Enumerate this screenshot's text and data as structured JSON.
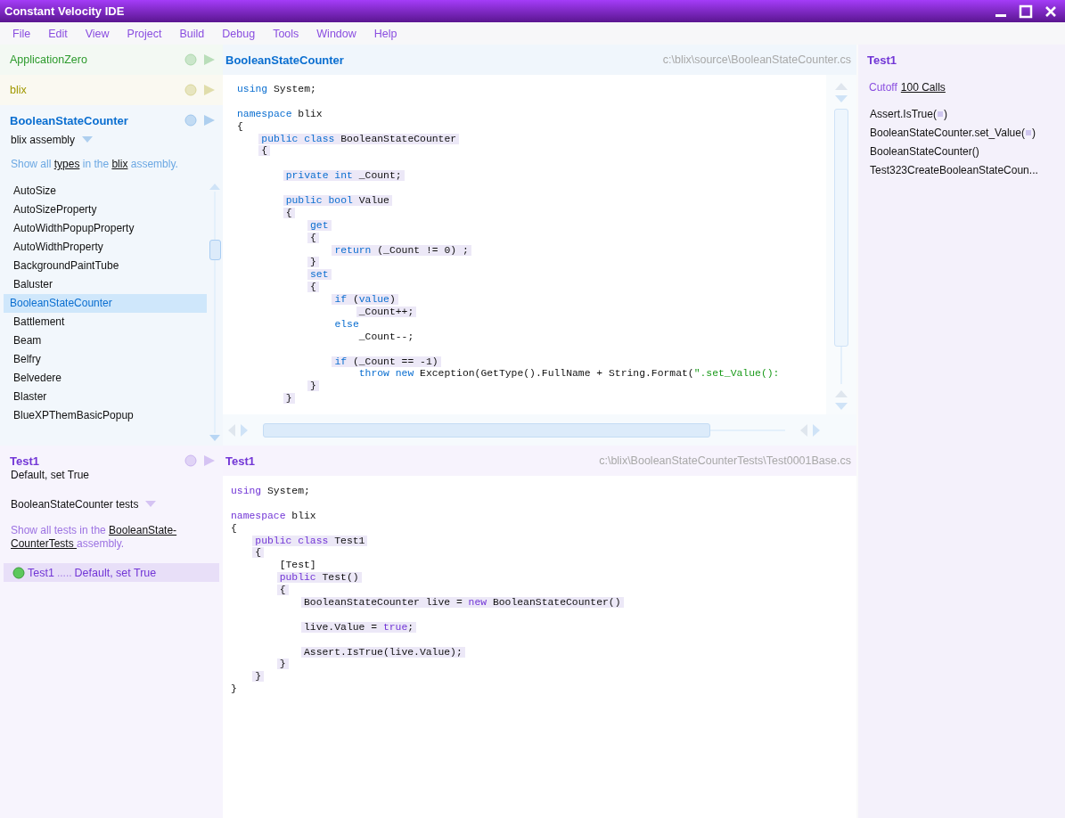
{
  "window": {
    "title": "Constant Velocity IDE"
  },
  "menu": [
    "File",
    "Edit",
    "View",
    "Project",
    "Build",
    "Debug",
    "Tools",
    "Window",
    "Help"
  ],
  "projects": [
    {
      "name": "ApplicationZero",
      "color": "#2c9a2c",
      "expanded": false
    },
    {
      "name": "blix",
      "color": "#a09800",
      "expanded": false
    },
    {
      "name": "BooleanStateCounter",
      "color": "#0a6ed0",
      "expanded": true,
      "assembly": "blix assembly",
      "description": [
        {
          "text": "Show all ",
          "link": false
        },
        {
          "text": "types",
          "link": true
        },
        {
          "text": " in the ",
          "link": false
        },
        {
          "text": "blix",
          "link": true
        },
        {
          "text": " assembly.",
          "link": false
        }
      ],
      "types": [
        {
          "name": "AutoSize",
          "selected": false
        },
        {
          "name": "AutoSizeProperty",
          "selected": false
        },
        {
          "name": "AutoWidthPopupProperty",
          "selected": false
        },
        {
          "name": "AutoWidthProperty",
          "selected": false
        },
        {
          "name": "BackgroundPaintTube",
          "selected": false
        },
        {
          "name": "Baluster",
          "selected": false
        },
        {
          "name": "BooleanStateCounter",
          "selected": true
        },
        {
          "name": "Battlement",
          "selected": false
        },
        {
          "name": "Beam",
          "selected": false
        },
        {
          "name": "Belfry",
          "selected": false
        },
        {
          "name": "Belvedere",
          "selected": false
        },
        {
          "name": "Blaster",
          "selected": false
        },
        {
          "name": "BlueXPThemBasicPopup",
          "selected": false
        }
      ]
    }
  ],
  "test_panel": {
    "title": "Test1",
    "subtitle": "Default, set True",
    "color": "#7236d6",
    "assembly": "BooleanStateCounter tests",
    "description": [
      {
        "text": "Show all tests in the ",
        "link": false
      },
      {
        "text": "BooleanState-",
        "link": true
      },
      {
        "text": "CounterTests ",
        "link": true
      },
      {
        "text": "assembly.",
        "link": false
      }
    ],
    "results": [
      {
        "name": "Test1",
        "dots": ".....",
        "detail": "Default, set True",
        "passed": true,
        "selected": true
      }
    ]
  },
  "editors": [
    {
      "title": "BooleanStateCounter",
      "path": "c:\\blix\\source\\BooleanStateCounter.cs",
      "color": "#0a6ed0",
      "lines": [
        {
          "tokens": [
            {
              "kind": "kw",
              "text": "using"
            },
            {
              "kind": "plain",
              "text": " System;"
            }
          ],
          "highlighted": false,
          "space_before": false
        },
        {
          "tokens": [
            {
              "kind": "kw",
              "text": "namespace"
            },
            {
              "kind": "plain",
              "text": " blix"
            }
          ],
          "highlighted": false,
          "space_before": true
        },
        {
          "tokens": [
            {
              "kind": "plain",
              "text": "{"
            }
          ],
          "highlighted": false,
          "space_before": false
        },
        {
          "tokens": [
            {
              "kind": "kw",
              "text": "    public class"
            },
            {
              "kind": "plain",
              "text": " BooleanStateCounter"
            }
          ],
          "highlighted": true,
          "space_before": false
        },
        {
          "tokens": [
            {
              "kind": "plain",
              "text": "    {"
            }
          ],
          "highlighted": true,
          "space_before": false
        },
        {
          "tokens": [
            {
              "kind": "kw",
              "text": "        private int"
            },
            {
              "kind": "plain",
              "text": " _Count;"
            }
          ],
          "highlighted": true,
          "space_before": true
        },
        {
          "tokens": [
            {
              "kind": "kw",
              "text": "        public bool"
            },
            {
              "kind": "plain",
              "text": " Value"
            }
          ],
          "highlighted": true,
          "space_before": true
        },
        {
          "tokens": [
            {
              "kind": "plain",
              "text": "        {"
            }
          ],
          "highlighted": true,
          "space_before": false
        },
        {
          "tokens": [
            {
              "kind": "kw",
              "text": "            get"
            }
          ],
          "highlighted": true,
          "space_before": false
        },
        {
          "tokens": [
            {
              "kind": "plain",
              "text": "            {"
            }
          ],
          "highlighted": true,
          "space_before": false
        },
        {
          "tokens": [
            {
              "kind": "kw",
              "text": "                return"
            },
            {
              "kind": "plain",
              "text": " (_Count != 0) ;"
            }
          ],
          "highlighted": true,
          "space_before": false
        },
        {
          "tokens": [
            {
              "kind": "plain",
              "text": "            }"
            }
          ],
          "highlighted": true,
          "space_before": false
        },
        {
          "tokens": [
            {
              "kind": "kw",
              "text": "            set"
            }
          ],
          "highlighted": true,
          "space_before": false
        },
        {
          "tokens": [
            {
              "kind": "plain",
              "text": "            {"
            }
          ],
          "highlighted": true,
          "space_before": false
        },
        {
          "tokens": [
            {
              "kind": "kw",
              "text": "                if"
            },
            {
              "kind": "plain",
              "text": " ("
            },
            {
              "kind": "kw",
              "text": "value"
            },
            {
              "kind": "plain",
              "text": ")"
            }
          ],
          "highlighted": true,
          "space_before": false
        },
        {
          "tokens": [
            {
              "kind": "plain",
              "text": "                    _Count++;"
            }
          ],
          "highlighted": true,
          "space_before": false
        },
        {
          "tokens": [
            {
              "kind": "kw",
              "text": "                else"
            }
          ],
          "highlighted": false,
          "space_before": false
        },
        {
          "tokens": [
            {
              "kind": "plain",
              "text": "                    _Count--;"
            }
          ],
          "highlighted": false,
          "space_before": false
        },
        {
          "tokens": [
            {
              "kind": "kw",
              "text": "                if"
            },
            {
              "kind": "plain",
              "text": " (_Count == -1)"
            }
          ],
          "highlighted": true,
          "space_before": true
        },
        {
          "tokens": [
            {
              "kind": "kw",
              "text": "                    throw new"
            },
            {
              "kind": "plain",
              "text": " Exception(GetType().FullName + String.Format("
            },
            {
              "kind": "str",
              "text": "\".set_Value():"
            }
          ],
          "highlighted": false,
          "space_before": false
        },
        {
          "tokens": [
            {
              "kind": "plain",
              "text": "            }"
            }
          ],
          "highlighted": true,
          "space_before": false
        },
        {
          "tokens": [
            {
              "kind": "plain",
              "text": "        }"
            }
          ],
          "highlighted": true,
          "space_before": false
        }
      ]
    },
    {
      "title": "Test1",
      "path": "c:\\blix\\BooleanStateCounterTests\\Test0001Base.cs",
      "color": "#7236d6",
      "lines": [
        {
          "tokens": [
            {
              "kind": "kw",
              "text": "using"
            },
            {
              "kind": "plain",
              "text": " System;"
            }
          ],
          "highlighted": false,
          "space_before": false
        },
        {
          "tokens": [
            {
              "kind": "kw",
              "text": "namespace"
            },
            {
              "kind": "plain",
              "text": " blix"
            }
          ],
          "highlighted": false,
          "space_before": true
        },
        {
          "tokens": [
            {
              "kind": "plain",
              "text": "{"
            }
          ],
          "highlighted": false,
          "space_before": false
        },
        {
          "tokens": [
            {
              "kind": "kw",
              "text": "    public class"
            },
            {
              "kind": "plain",
              "text": " Test1"
            }
          ],
          "highlighted": true,
          "space_before": false
        },
        {
          "tokens": [
            {
              "kind": "plain",
              "text": "    {"
            }
          ],
          "highlighted": true,
          "space_before": false
        },
        {
          "tokens": [
            {
              "kind": "plain",
              "text": "        [Test]"
            }
          ],
          "highlighted": false,
          "space_before": false
        },
        {
          "tokens": [
            {
              "kind": "kw",
              "text": "        public"
            },
            {
              "kind": "plain",
              "text": " Test()"
            }
          ],
          "highlighted": true,
          "space_before": false
        },
        {
          "tokens": [
            {
              "kind": "plain",
              "text": "        {"
            }
          ],
          "highlighted": true,
          "space_before": false
        },
        {
          "tokens": [
            {
              "kind": "plain",
              "text": "            BooleanStateCounter live = "
            },
            {
              "kind": "kw",
              "text": "new"
            },
            {
              "kind": "plain",
              "text": " BooleanStateCounter()"
            }
          ],
          "highlighted": true,
          "space_before": false
        },
        {
          "tokens": [
            {
              "kind": "plain",
              "text": "            live.Value = "
            },
            {
              "kind": "kw",
              "text": "true"
            },
            {
              "kind": "plain",
              "text": ";"
            }
          ],
          "highlighted": true,
          "space_before": true
        },
        {
          "tokens": [
            {
              "kind": "plain",
              "text": "            Assert.IsTrue(live.Value);"
            }
          ],
          "highlighted": true,
          "space_before": true
        },
        {
          "tokens": [
            {
              "kind": "plain",
              "text": "        }"
            }
          ],
          "highlighted": true,
          "space_before": false
        },
        {
          "tokens": [
            {
              "kind": "plain",
              "text": "    }"
            }
          ],
          "highlighted": true,
          "space_before": false
        },
        {
          "tokens": [
            {
              "kind": "plain",
              "text": "}"
            }
          ],
          "highlighted": false,
          "space_before": false
        }
      ]
    }
  ],
  "call_panel": {
    "title": "Test1",
    "cutoff_label": "Cutoff",
    "cutoff_link": "100 Calls",
    "calls": [
      {
        "before": "Assert.IsTrue(",
        "param": true,
        "after": ")"
      },
      {
        "before": "BooleanStateCounter.set_Value(",
        "param": true,
        "after": ")"
      },
      {
        "before": "BooleanStateCounter()",
        "param": false
      },
      {
        "before": "Test323CreateBooleanStateCoun...",
        "param": false
      }
    ]
  }
}
